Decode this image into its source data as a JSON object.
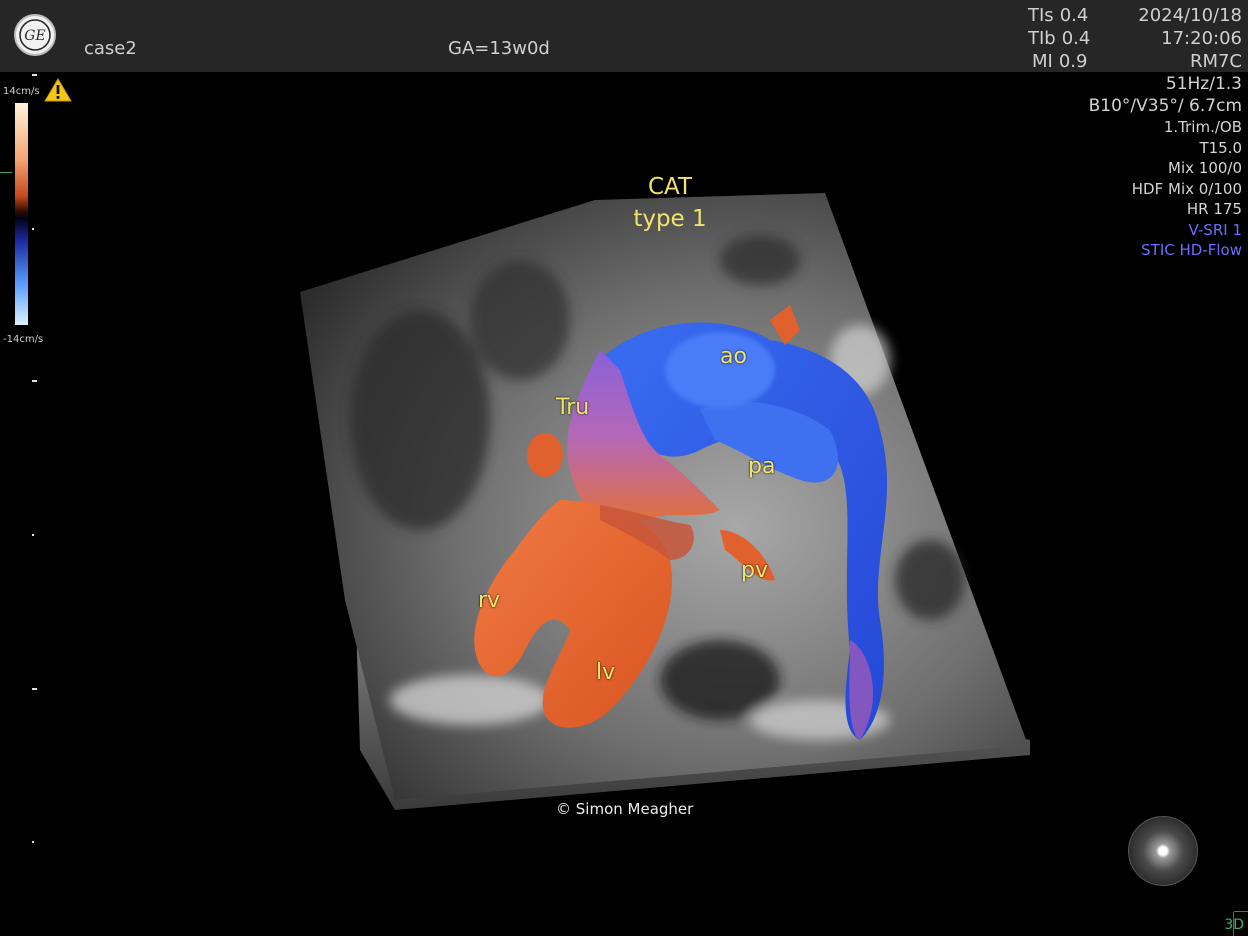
{
  "header": {
    "patient_id": "case2",
    "gestational_age": "GA=13w0d",
    "tis_label": "TIs",
    "tis_value": "0.4",
    "tib_label": "TIb",
    "tib_value": "0.4",
    "mi_label": "MI",
    "mi_value": "0.9",
    "date": "2024/10/18",
    "time": "17:20:06",
    "probe": "RM7C"
  },
  "params": {
    "frame_rate": "51Hz/1.3",
    "volume": "B10°/V35°/ 6.7cm",
    "preset": "1.Trim./OB",
    "freq": "T15.0",
    "mix": "Mix 100/0",
    "hdf_mix": "HDF Mix 0/100",
    "heart_rate": "HR 175",
    "vsri": "V-SRI 1",
    "mode": "STIC HD-Flow"
  },
  "colors": {
    "accent_blue_text": "#6d6dff",
    "annotation_yellow": "#f1e36c",
    "flow_red": "#e0612d",
    "flow_blue": "#2f5fe8",
    "mode_green": "#40b070"
  },
  "color_scale": {
    "top_label": "14cm/s",
    "bottom_label": "-14cm/s"
  },
  "annotations": {
    "title_line1": "CAT",
    "title_line2": "type 1",
    "ao": "ao",
    "tru": "Tru",
    "pa": "pa",
    "pv": "pv",
    "rv": "rv",
    "lv": "lv"
  },
  "copyright": "© Simon Meagher",
  "mode_indicator": "3D",
  "icons": {
    "logo": "ge-logo-icon",
    "warning": "warning-triangle-icon",
    "orientation": "orientation-sphere-icon"
  }
}
